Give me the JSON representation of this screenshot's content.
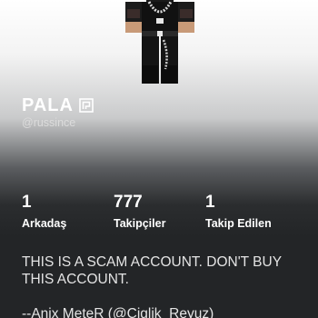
{
  "profile": {
    "display_name": "PALA",
    "username": "@russince",
    "premium_icon": "premium-badge-icon",
    "avatar_icon": "avatar-render"
  },
  "stats": [
    {
      "value": "1",
      "label": "Arkadaş"
    },
    {
      "value": "777",
      "label": "Takipçiler"
    },
    {
      "value": "1",
      "label": "Takip Edilen"
    }
  ],
  "bio": "THIS IS A SCAM ACCOUNT. DON'T BUY THIS ACCOUNT.\n\n--Anix MeteR (@Ciglik_Reyuz)",
  "colors": {
    "text": "#ffffff",
    "background_dark": "#232527"
  }
}
